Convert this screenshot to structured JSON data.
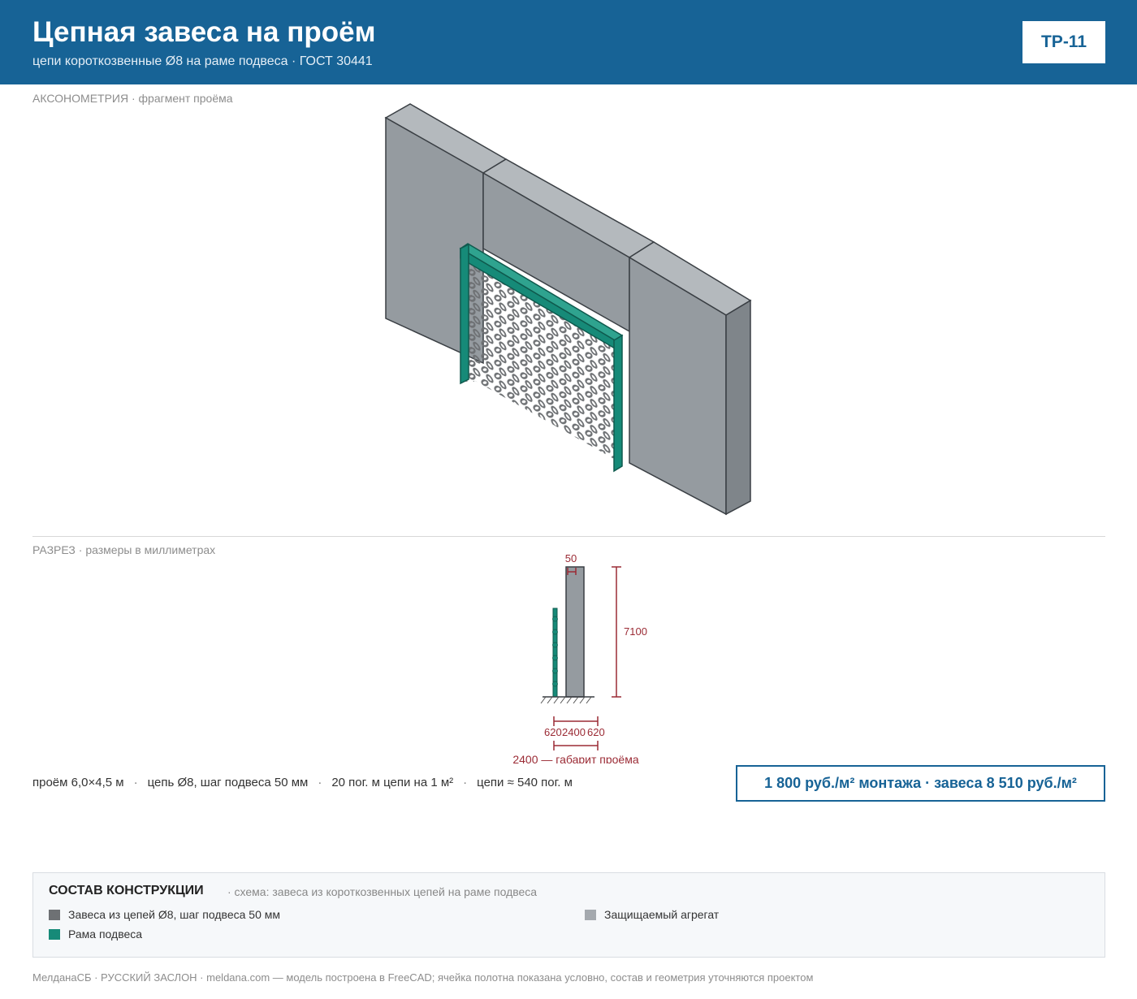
{
  "header": {
    "title": "Цепная завеса на проём",
    "subtitle": "цепи короткозвенные Ø8 на раме подвеса · ГОСТ 30441",
    "code": "ТР-11"
  },
  "axonometry": {
    "label": "АКСОНОМЕТРИЯ",
    "note": "· фрагмент проёма"
  },
  "section": {
    "label": "РАЗРЕЗ",
    "note": "· размеры в миллиметрах",
    "dims": {
      "top": "50",
      "height": "7100",
      "left": "620",
      "middle": "2400",
      "right": "620",
      "total": "2400 — габарит проёма"
    }
  },
  "facts": [
    "проём 6,0×4,5 м",
    "цепь Ø8, шаг подвеса 50 мм",
    "20 пог. м цепи на 1 м²",
    "цепи ≈ 540 пог. м"
  ],
  "facts_separator": "·",
  "price": "1 800 руб./м² монтажа · завеса 8 510 руб./м²",
  "legend": {
    "title": "СОСТАВ КОНСТРУКЦИИ",
    "note": "· схема: завеса из короткозвенных цепей на раме подвеса",
    "items": [
      {
        "label": "Завеса из цепей Ø8, шаг подвеса 50 мм",
        "color": "#6e7174"
      },
      {
        "label": "Защищаемый агрегат",
        "color": "#a4a9ae"
      },
      {
        "label": "Рама подвеса",
        "color": "#168a78"
      }
    ]
  },
  "footer": "МелданаСБ · РУССКИЙ ЗАСЛОН · meldana.com — модель построена в FreeCAD; ячейка полотна показана условно, состав и геометрия уточняются проектом",
  "colors": {
    "brand": "#176396",
    "wall_front": "#959ba0",
    "wall_top": "#b4b9bd",
    "wall_side": "#7f858a",
    "frame": "#168a78",
    "chain": "#6e7174",
    "dimension": "#9b2b35"
  }
}
